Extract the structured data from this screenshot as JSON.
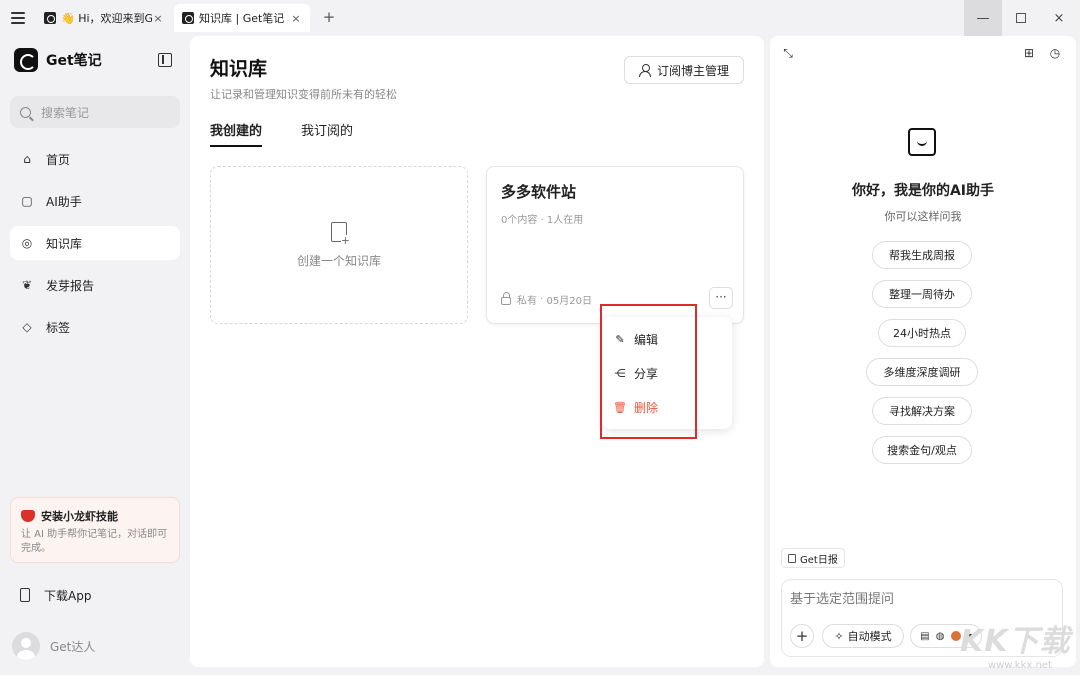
{
  "tabs": [
    {
      "label": "👋 Hi，欢迎来到Get笔记",
      "close": "×"
    },
    {
      "label": "知识库 | Get笔记",
      "close": "×"
    }
  ],
  "new_tab": "+",
  "window": {
    "minimize": "—",
    "close": "×"
  },
  "sidebar": {
    "brand": "Get笔记",
    "search_placeholder": "搜索笔记",
    "nav": [
      {
        "label": "首页",
        "icon": "home-icon"
      },
      {
        "label": "AI助手",
        "icon": "ai-assistant-icon"
      },
      {
        "label": "知识库",
        "icon": "knowledge-base-icon",
        "active": true
      },
      {
        "label": "发芽报告",
        "icon": "sprout-icon"
      },
      {
        "label": "标签",
        "icon": "tag-icon"
      }
    ],
    "promo": {
      "title": "安装小龙虾技能",
      "desc": "让 AI 助手帮你记笔记，对话即可完成。"
    },
    "download": "下载App",
    "user": "Get达人"
  },
  "main": {
    "title": "知识库",
    "subtitle": "让记录和管理知识变得前所未有的轻松",
    "subscribe_button": "订阅博主管理",
    "tabs": [
      "我创建的",
      "我订阅的"
    ],
    "create_card": "创建一个知识库",
    "kb_card": {
      "title": "多多软件站",
      "meta": "0个内容 · 1人在用",
      "privacy": "私有",
      "date": "05月20日",
      "more": "···"
    },
    "context_menu": [
      "编辑",
      "分享",
      "删除"
    ]
  },
  "ai": {
    "greeting": "你好，我是你的AI助手",
    "sub": "你可以这样问我",
    "suggestions": [
      "帮我生成周报",
      "整理一周待办",
      "24小时热点",
      "多维度深度调研",
      "寻找解决方案",
      "搜索金句/观点"
    ],
    "daily": "Get日报",
    "prompt_placeholder": "基于选定范围提问",
    "mode": "自动模式"
  },
  "colors": {
    "accent": "#111111",
    "danger": "#e4573b",
    "highlight": "#e02a2a"
  },
  "watermark": {
    "logo": "KK下载",
    "url": "www.kkx.net"
  }
}
